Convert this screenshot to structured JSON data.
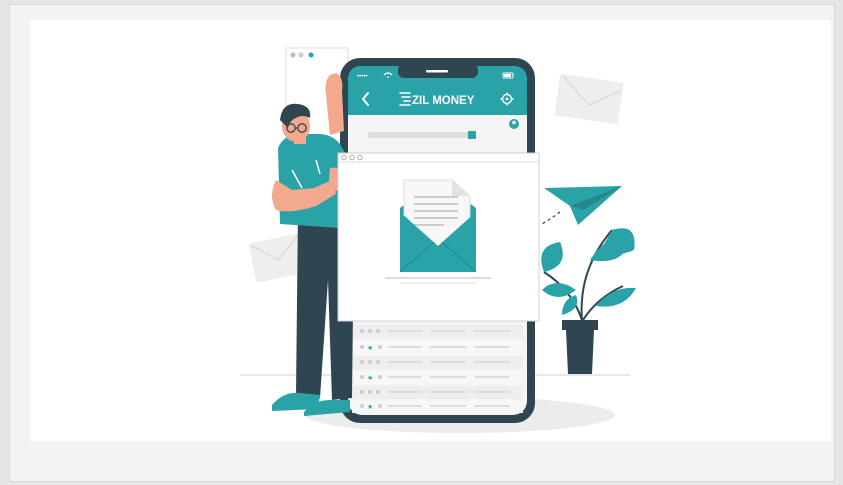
{
  "brand": {
    "name": "ZIL MONEY",
    "logo_mark": "zil-money-logo-icon"
  },
  "phone": {
    "status_bar": {
      "signal": "•••••",
      "wifi_icon": "wifi-icon",
      "battery_icon": "battery-icon"
    },
    "header": {
      "back_icon": "chevron-left-icon",
      "settings_icon": "gear-icon"
    }
  },
  "colors": {
    "accent": "#2aa3a8",
    "dark": "#2f4550",
    "skin": "#f3a98e",
    "light_gray": "#ececec"
  }
}
